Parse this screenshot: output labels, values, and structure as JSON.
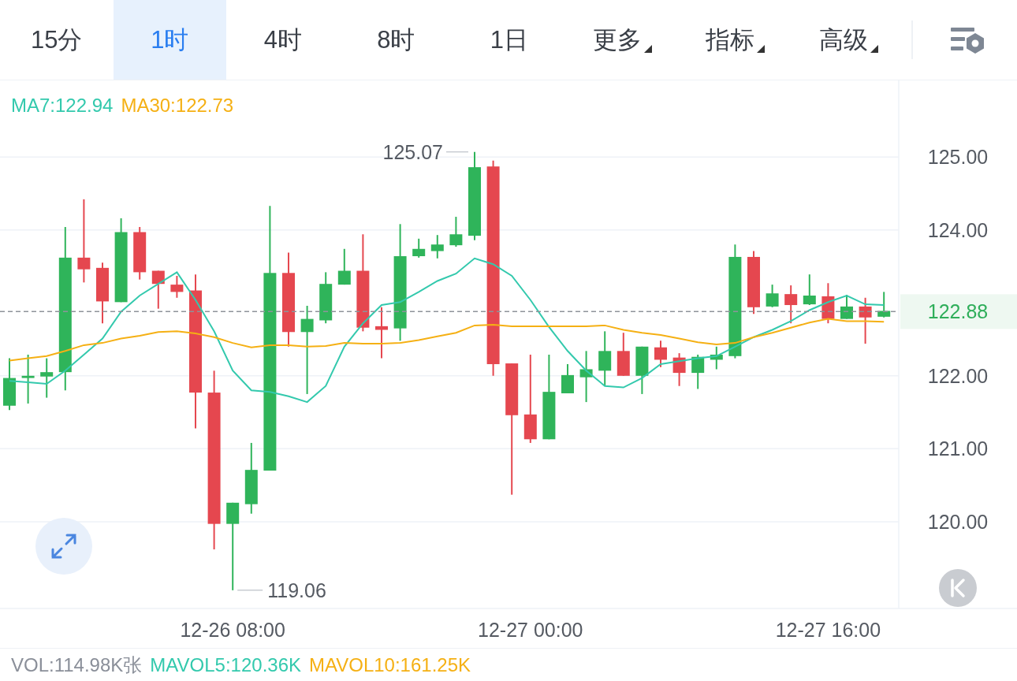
{
  "tabs": [
    {
      "label": "15分",
      "kind": "plain",
      "selected": false
    },
    {
      "label": "1时",
      "kind": "plain",
      "selected": true
    },
    {
      "label": "4时",
      "kind": "plain",
      "selected": false
    },
    {
      "label": "8时",
      "kind": "plain",
      "selected": false
    },
    {
      "label": "1日",
      "kind": "plain",
      "selected": false
    },
    {
      "label": "更多",
      "kind": "dropdown",
      "selected": false
    },
    {
      "label": "指标",
      "kind": "dropdown",
      "selected": false
    },
    {
      "label": "高级",
      "kind": "dropdown",
      "selected": false
    }
  ],
  "legend": [
    {
      "value": ":122.94"
    },
    {
      "value": ":122.73"
    }
  ],
  "chart": {
    "chart_data": {
      "type": "candlestick",
      "grid": true,
      "ylim": [
        118.81,
        126.05
      ],
      "categories": [
        null,
        null,
        null,
        null,
        null,
        null,
        null,
        null,
        null,
        null,
        null,
        null,
        "12-26 08:00",
        null,
        null,
        null,
        null,
        null,
        null,
        null,
        null,
        null,
        null,
        null,
        null,
        null,
        null,
        null,
        "12-27 00:00",
        null,
        null,
        null,
        null,
        null,
        null,
        null,
        null,
        null,
        null,
        null,
        null,
        null,
        null,
        null,
        "12-27 16:00",
        null,
        null,
        null
      ],
      "yticks": [
        {
          "value": 125,
          "label": "125.00"
        },
        {
          "value": 124,
          "label": "124.00"
        },
        {
          "value": 122,
          "label": "122.00"
        },
        {
          "value": 121,
          "label": "121.00"
        },
        {
          "value": 120,
          "label": "120.00"
        }
      ],
      "ohlc": [
        [
          121.59,
          122.24,
          121.53,
          121.97
        ],
        [
          121.97,
          122.29,
          121.62,
          122.0
        ],
        [
          121.99,
          122.24,
          121.7,
          122.05
        ],
        [
          122.05,
          124.04,
          121.8,
          123.62
        ],
        [
          123.62,
          124.42,
          123.28,
          123.46
        ],
        [
          123.48,
          123.55,
          122.72,
          123.02
        ],
        [
          123.01,
          124.16,
          123.01,
          123.97
        ],
        [
          123.97,
          124.04,
          123.32,
          123.42
        ],
        [
          123.44,
          123.44,
          122.92,
          123.26
        ],
        [
          123.25,
          123.37,
          123.07,
          123.15
        ],
        [
          123.17,
          123.39,
          121.28,
          121.77
        ],
        [
          121.77,
          122.07,
          119.62,
          119.97
        ],
        [
          119.97,
          120.26,
          119.06,
          120.26
        ],
        [
          120.24,
          121.08,
          120.11,
          120.71
        ],
        [
          120.7,
          124.33,
          120.7,
          123.41
        ],
        [
          123.41,
          123.69,
          122.4,
          122.6
        ],
        [
          122.6,
          122.96,
          121.75,
          122.78
        ],
        [
          122.76,
          123.42,
          122.72,
          123.26
        ],
        [
          123.25,
          123.74,
          123.25,
          123.44
        ],
        [
          123.44,
          123.94,
          122.61,
          122.66
        ],
        [
          122.68,
          122.94,
          122.24,
          122.63
        ],
        [
          122.65,
          124.08,
          122.48,
          123.64
        ],
        [
          123.64,
          123.88,
          123.62,
          123.74
        ],
        [
          123.71,
          123.93,
          123.61,
          123.8
        ],
        [
          123.79,
          124.18,
          123.77,
          123.94
        ],
        [
          123.92,
          125.07,
          123.86,
          124.86
        ],
        [
          124.87,
          124.95,
          122.0,
          122.16
        ],
        [
          122.17,
          122.17,
          120.37,
          121.46
        ],
        [
          121.47,
          122.29,
          121.08,
          121.13
        ],
        [
          121.13,
          122.29,
          121.13,
          121.78
        ],
        [
          121.76,
          122.16,
          121.76,
          122.01
        ],
        [
          121.98,
          122.34,
          121.64,
          122.09
        ],
        [
          122.07,
          122.61,
          121.86,
          122.34
        ],
        [
          122.34,
          122.59,
          122.0,
          122.0
        ],
        [
          122.0,
          122.4,
          121.75,
          122.4
        ],
        [
          122.39,
          122.48,
          122.12,
          122.22
        ],
        [
          122.25,
          122.31,
          121.86,
          122.04
        ],
        [
          122.04,
          122.29,
          121.82,
          122.26
        ],
        [
          122.22,
          122.4,
          122.09,
          122.29
        ],
        [
          122.27,
          123.8,
          122.24,
          123.63
        ],
        [
          123.63,
          123.71,
          122.85,
          122.94
        ],
        [
          122.95,
          123.25,
          122.94,
          123.13
        ],
        [
          123.12,
          123.24,
          122.72,
          122.97
        ],
        [
          122.98,
          123.39,
          122.97,
          123.1
        ],
        [
          123.09,
          123.27,
          122.72,
          122.78
        ],
        [
          122.78,
          123.11,
          122.78,
          122.95
        ],
        [
          122.95,
          123.07,
          122.44,
          122.8
        ],
        [
          122.81,
          123.15,
          122.8,
          122.89
        ]
      ],
      "series": [
        {
          "name": "MA7",
          "type": "line",
          "color": "#33c9ad",
          "values": [
            121.93,
            121.91,
            121.89,
            122.07,
            122.29,
            122.51,
            122.88,
            123.1,
            123.26,
            123.42,
            123.04,
            122.61,
            122.07,
            121.8,
            121.78,
            121.72,
            121.64,
            121.86,
            122.4,
            122.72,
            122.97,
            123.01,
            123.15,
            123.3,
            123.4,
            123.61,
            123.53,
            123.37,
            123.04,
            122.67,
            122.34,
            122.07,
            121.86,
            121.84,
            121.97,
            122.16,
            122.2,
            122.24,
            122.27,
            122.4,
            122.53,
            122.63,
            122.75,
            122.9,
            123.01,
            123.1,
            122.98,
            122.97
          ]
        },
        {
          "name": "MA30",
          "type": "line",
          "color": "#f5b014",
          "values": [
            122.21,
            122.24,
            122.27,
            122.34,
            122.42,
            122.45,
            122.51,
            122.55,
            122.6,
            122.61,
            122.58,
            122.53,
            122.45,
            122.39,
            122.42,
            122.42,
            122.4,
            122.41,
            122.45,
            122.44,
            122.44,
            122.45,
            122.49,
            122.54,
            122.59,
            122.69,
            122.7,
            122.68,
            122.68,
            122.68,
            122.68,
            122.68,
            122.69,
            122.63,
            122.59,
            122.56,
            122.51,
            122.46,
            122.43,
            122.45,
            122.53,
            122.59,
            122.66,
            122.73,
            122.78,
            122.75,
            122.75,
            122.74
          ]
        }
      ],
      "ref_lines": [
        {
          "axis": "y",
          "value": 122.88,
          "label": "122.88"
        }
      ],
      "annotations": [
        "125.07",
        "119.06"
      ]
    }
  },
  "volume": [
    {
      "text": "VOL:114.98K张",
      "color": "#8a8f99"
    },
    {
      "text": "MAVOL5:120.36K",
      "color": "#33c9ad"
    },
    {
      "text": "MAVOL10:161.25K",
      "color": "#f5b014"
    }
  ]
}
